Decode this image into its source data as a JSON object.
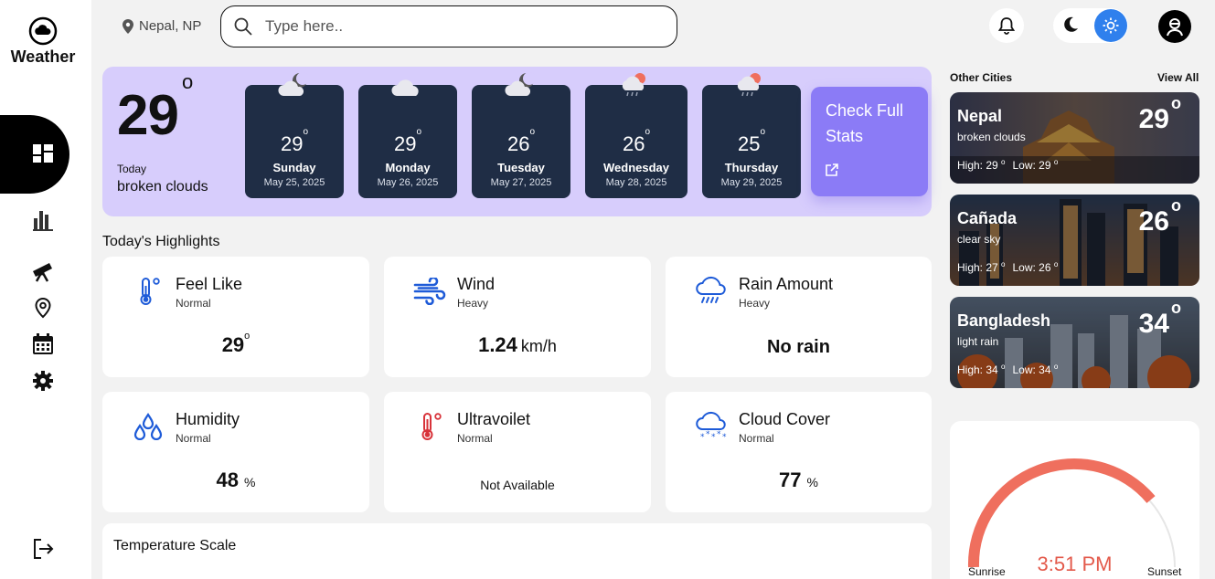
{
  "app": {
    "title": "Weather"
  },
  "header": {
    "location": "Nepal, NP",
    "search_placeholder": "Type here.."
  },
  "current": {
    "temp": "29",
    "degree": "o",
    "today_label": "Today",
    "condition": "broken clouds"
  },
  "forecast": [
    {
      "temp": "29",
      "day": "Sunday",
      "date": "May 25, 2025",
      "icon": "cloud-moon-icon"
    },
    {
      "temp": "29",
      "day": "Monday",
      "date": "May 26, 2025",
      "icon": "cloud-icon"
    },
    {
      "temp": "26",
      "day": "Tuesday",
      "date": "May 27, 2025",
      "icon": "cloud-moon-icon"
    },
    {
      "temp": "26",
      "day": "Wednesday",
      "date": "May 28, 2025",
      "icon": "rain-sun-icon"
    },
    {
      "temp": "25",
      "day": "Thursday",
      "date": "May 29, 2025",
      "icon": "rain-sun-icon"
    }
  ],
  "check_stats": {
    "label": "Check Full Stats"
  },
  "highlights": {
    "title": "Today's Highlights",
    "feel_like": {
      "name": "Feel Like",
      "sub": "Normal",
      "value": "29",
      "sup": "o"
    },
    "wind": {
      "name": "Wind",
      "sub": "Heavy",
      "value": "1.24",
      "unit": "km/h"
    },
    "rain": {
      "name": "Rain Amount",
      "sub": "Heavy",
      "value": "No rain"
    },
    "humidity": {
      "name": "Humidity",
      "sub": "Normal",
      "value": "48",
      "unit": "%"
    },
    "uv": {
      "name": "Ultravoilet",
      "sub": "Normal",
      "value": "Not Available"
    },
    "cloud": {
      "name": "Cloud Cover",
      "sub": "Normal",
      "value": "77",
      "unit": "%"
    }
  },
  "temperature_scale": {
    "title": "Temperature Scale"
  },
  "other_cities": {
    "title": "Other Cities",
    "view_all": "View All",
    "cities": [
      {
        "name": "Nepal",
        "desc": "broken clouds",
        "temp": "29",
        "high": "High: 29",
        "low": "Low: 29"
      },
      {
        "name": "Cañada",
        "desc": "clear sky",
        "temp": "26",
        "high": "High: 27",
        "low": "Low: 26"
      },
      {
        "name": "Bangladesh",
        "desc": "light rain",
        "temp": "34",
        "high": "High: 34",
        "low": "Low: 34"
      }
    ],
    "degree": "o"
  },
  "sun": {
    "time": "3:51 PM",
    "sunrise": "Sunrise",
    "sunset": "Sunset",
    "arc_color": "#ef6f5e"
  },
  "colors": {
    "hero_bg": "#d7cdfc",
    "day_card": "#1f2d45",
    "stats_bg": "#8b7bf6",
    "accent_blue": "#2f80ed",
    "icon_blue": "#1e5bd8",
    "icon_red": "#d8333a"
  }
}
